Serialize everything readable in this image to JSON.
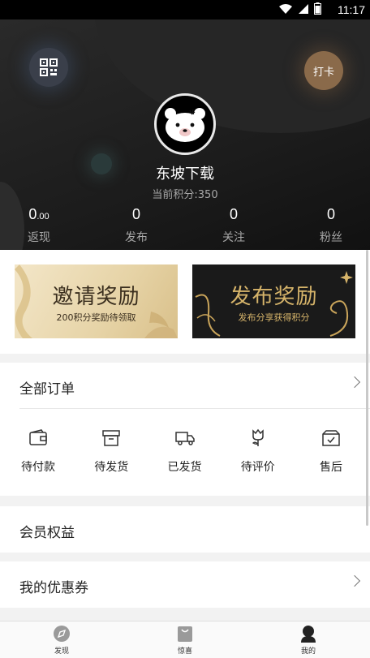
{
  "status_bar": {
    "time": "11:17"
  },
  "profile": {
    "checkin_label": "打卡",
    "username": "东坡下载",
    "points_text": "当前积分:350",
    "stats": [
      {
        "value_main": "0",
        "value_decimal": ".00",
        "label": "返现"
      },
      {
        "value_main": "0",
        "value_decimal": "",
        "label": "发布"
      },
      {
        "value_main": "0",
        "value_decimal": "",
        "label": "关注"
      },
      {
        "value_main": "0",
        "value_decimal": "",
        "label": "粉丝"
      }
    ]
  },
  "banners": {
    "invite": {
      "title": "邀请奖励",
      "subtitle": "200积分奖励待领取"
    },
    "publish": {
      "title": "发布奖励",
      "subtitle": "发布分享获得积分"
    }
  },
  "orders": {
    "title": "全部订单",
    "items": [
      {
        "label": "待付款",
        "icon": "wallet-icon"
      },
      {
        "label": "待发货",
        "icon": "box-icon"
      },
      {
        "label": "已发货",
        "icon": "truck-icon"
      },
      {
        "label": "待评价",
        "icon": "flower-icon"
      },
      {
        "label": "售后",
        "icon": "package-check-icon"
      }
    ]
  },
  "sections": {
    "member": "会员权益",
    "coupon": "我的优惠券"
  },
  "tabbar": [
    {
      "label": "发现",
      "icon": "compass-icon"
    },
    {
      "label": "惊喜",
      "icon": "shopping-bag-icon"
    },
    {
      "label": "我的",
      "icon": "user-icon"
    }
  ]
}
